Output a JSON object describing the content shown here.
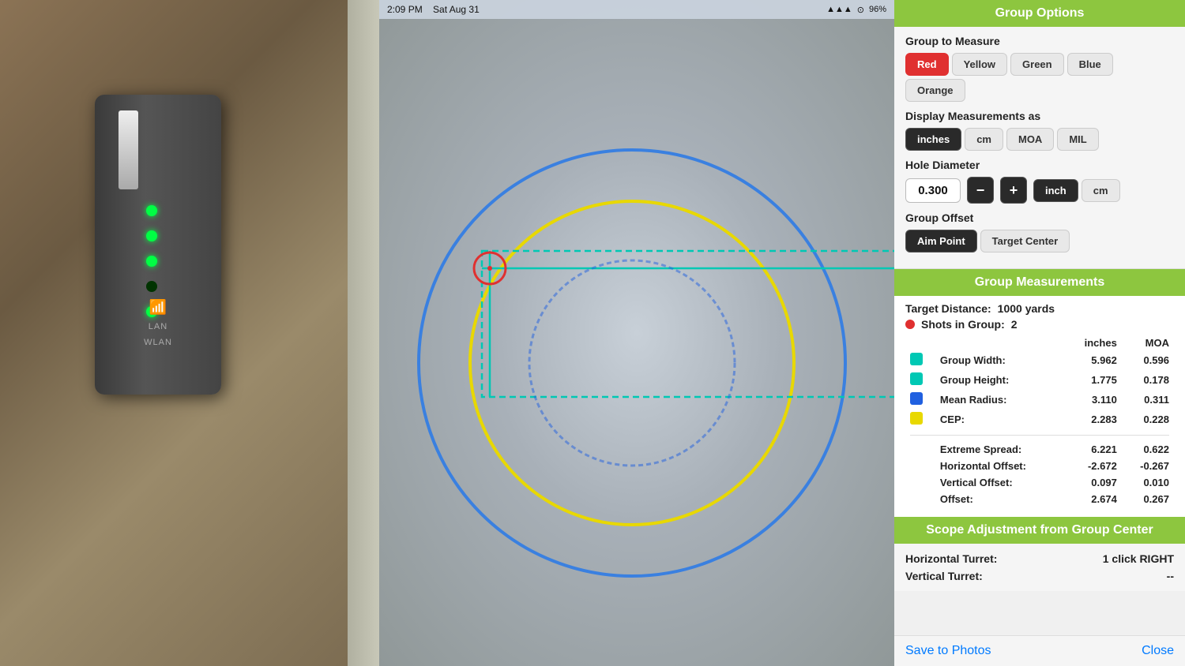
{
  "statusBar": {
    "time": "2:09 PM",
    "date": "Sat Aug 31",
    "signal": "▲▲▲",
    "wifi": "WiFi",
    "battery": "96%"
  },
  "rightPanel": {
    "groupOptions": {
      "header": "Group Options",
      "groupToMeasure": {
        "label": "Group to Measure",
        "buttons": [
          "Red",
          "Yellow",
          "Green",
          "Blue",
          "Orange"
        ],
        "active": "Red"
      },
      "displayMeasurements": {
        "label": "Display Measurements as",
        "buttons": [
          "inches",
          "cm",
          "MOA",
          "MIL"
        ],
        "active": "inches"
      },
      "holeDiameter": {
        "label": "Hole Diameter",
        "value": "0.300",
        "units": [
          "inch",
          "cm"
        ],
        "activeUnit": "inch",
        "decrementLabel": "−",
        "incrementLabel": "+"
      },
      "groupOffset": {
        "label": "Group Offset",
        "buttons": [
          "Aim Point",
          "Target Center"
        ],
        "active": "Aim Point"
      }
    },
    "groupMeasurements": {
      "header": "Group Measurements",
      "targetDistance": {
        "label": "Target Distance:",
        "value": "1000 yards"
      },
      "shotsInGroup": {
        "label": "Shots in Group:",
        "value": "2"
      },
      "tableHeaders": [
        "",
        "",
        "inches",
        "MOA"
      ],
      "rows": [
        {
          "swatch": "#00c8b4",
          "label": "Group Width:",
          "inches": "5.962",
          "moa": "0.596"
        },
        {
          "swatch": "#00c8b4",
          "label": "Group Height:",
          "inches": "1.775",
          "moa": "0.178"
        },
        {
          "swatch": "#2060e0",
          "label": "Mean Radius:",
          "inches": "3.110",
          "moa": "0.311"
        },
        {
          "swatch": "#e8d800",
          "label": "CEP:",
          "inches": "2.283",
          "moa": "0.228"
        },
        {
          "swatch": null,
          "label": "Extreme Spread:",
          "inches": "6.221",
          "moa": "0.622"
        },
        {
          "swatch": null,
          "label": "Horizontal Offset:",
          "inches": "-2.672",
          "moa": "-0.267"
        },
        {
          "swatch": null,
          "label": "Vertical Offset:",
          "inches": "0.097",
          "moa": "0.010"
        },
        {
          "swatch": null,
          "label": "Offset:",
          "inches": "2.674",
          "moa": "0.267"
        }
      ]
    },
    "scopeAdjustment": {
      "header": "Scope Adjustment from Group Center",
      "rows": [
        {
          "label": "Horizontal Turret:",
          "value": "1 click RIGHT"
        },
        {
          "label": "Vertical Turret:",
          "value": "--"
        }
      ]
    },
    "actions": {
      "saveLabel": "Save to Photos",
      "closeLabel": "Close"
    }
  }
}
